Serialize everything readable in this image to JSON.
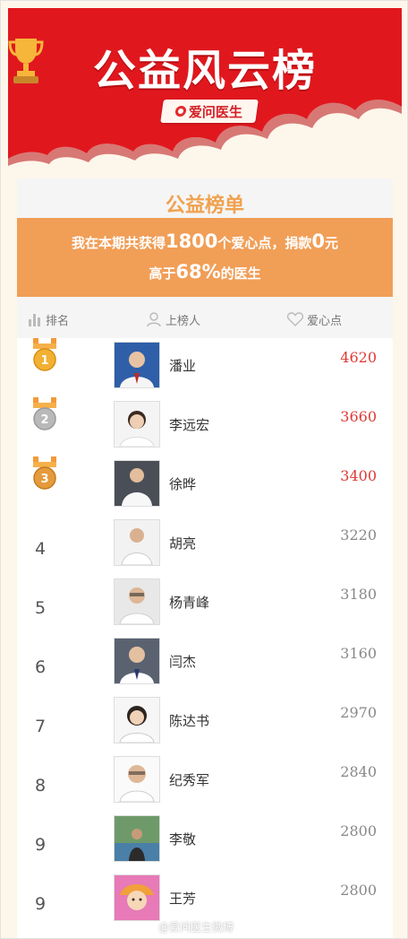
{
  "banner": {
    "title": "公益风云榜",
    "brand": "爱问医生",
    "icons": [
      "trophy-icon",
      "brand-logo"
    ]
  },
  "card": {
    "title": "公益榜单",
    "line1_pre": "我在本期共获得",
    "line1_points": "1800",
    "line1_mid": "个爱心点，捐款",
    "line1_money": "0",
    "line1_post": "元",
    "line2_pre": "高于",
    "line2_percent": "68%",
    "line2_post": "的医生"
  },
  "table": {
    "headers": {
      "rank": "排名",
      "person": "上榜人",
      "points": "爱心点"
    },
    "rows": [
      {
        "rank": "1",
        "name": "潘业",
        "points": "4620",
        "medal": "gold"
      },
      {
        "rank": "2",
        "name": "李远宏",
        "points": "3660",
        "medal": "silver"
      },
      {
        "rank": "3",
        "name": "徐晔",
        "points": "3400",
        "medal": "bronze"
      },
      {
        "rank": "4",
        "name": "胡亮",
        "points": "3220"
      },
      {
        "rank": "5",
        "name": "杨青峰",
        "points": "3180"
      },
      {
        "rank": "6",
        "name": "闫杰",
        "points": "3160"
      },
      {
        "rank": "7",
        "name": "陈达书",
        "points": "2970"
      },
      {
        "rank": "8",
        "name": "纪秀军",
        "points": "2840"
      },
      {
        "rank": "9",
        "name": "李敬",
        "points": "2800"
      },
      {
        "rank": "9",
        "name": "王芳",
        "points": "2800"
      }
    ]
  },
  "colors": {
    "banner_red": "#e0181e",
    "accent_orange": "#f19e57",
    "title_orange": "#f0a24f",
    "top_points_red": "#dd3b36"
  },
  "watermark": "@爱问医生微博"
}
